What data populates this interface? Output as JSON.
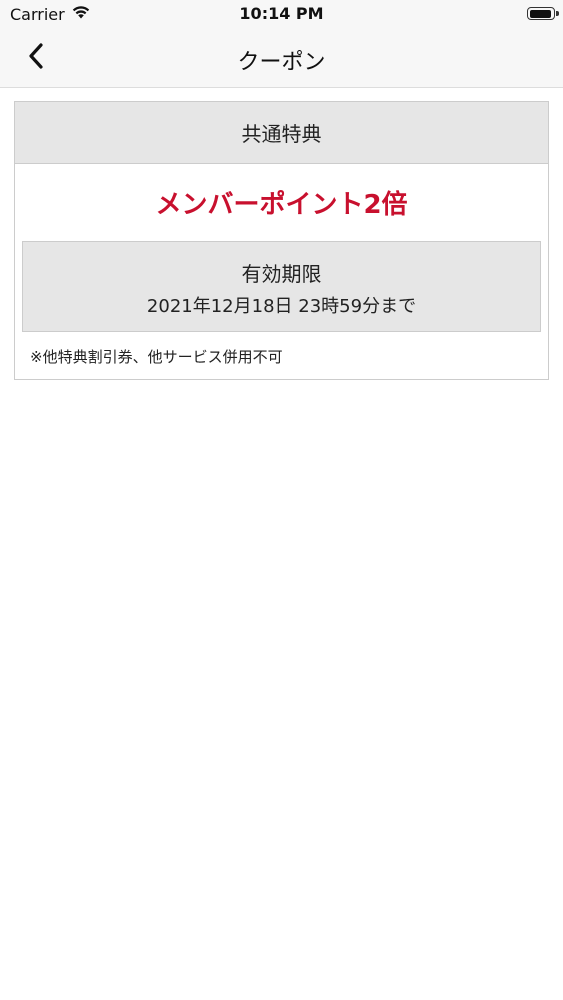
{
  "status_bar": {
    "carrier": "Carrier",
    "time": "10:14 PM",
    "battery_level": 0.95
  },
  "nav": {
    "back_icon": "chevron-left-icon",
    "title": "クーポン"
  },
  "coupon": {
    "header": "共通特典",
    "benefit": "メンバーポイント2倍",
    "benefit_color": "#c8102e",
    "expiry_label": "有効期限",
    "expiry_date": "2021年12月18日 23時59分まで",
    "note": "※他特典割引券、他サービス併用不可"
  }
}
